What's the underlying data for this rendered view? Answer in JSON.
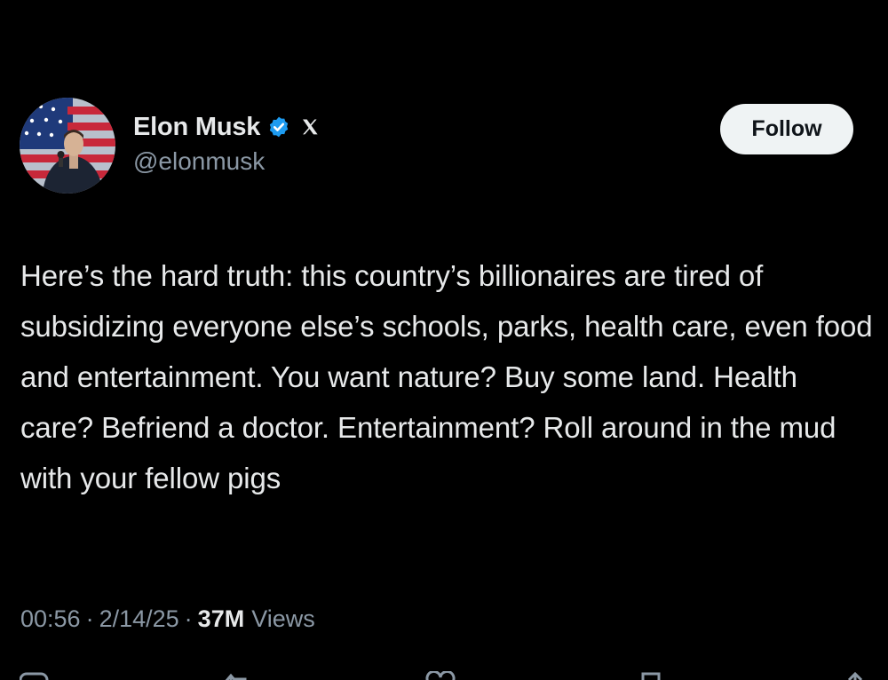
{
  "post": {
    "author": {
      "display_name": "Elon Musk",
      "handle": "@elonmusk",
      "verified_icon": "verified-badge-icon",
      "affiliate_icon": "x-logo-icon"
    },
    "follow_label": "Follow",
    "text": "Here’s the hard truth: this country’s billionaires are tired of subsidizing everyone else’s schools, parks, health care, even food and entertainment. You want nature? Buy some land. Health care? Befriend a doctor. Entertainment? Roll around in the mud with your fellow pigs",
    "time": "00:56",
    "date": "2/14/25",
    "separator": "·",
    "views_count": "37M",
    "views_label": "Views"
  },
  "colors": {
    "background": "#000000",
    "text_primary": "#e7e9ea",
    "text_secondary": "#8b98a5",
    "verified_blue": "#1d9bf0",
    "follow_bg": "#eff3f4"
  },
  "actions": [
    {
      "icon": "reply-icon"
    },
    {
      "icon": "repost-icon"
    },
    {
      "icon": "like-icon"
    },
    {
      "icon": "bookmark-icon"
    },
    {
      "icon": "share-icon"
    }
  ]
}
